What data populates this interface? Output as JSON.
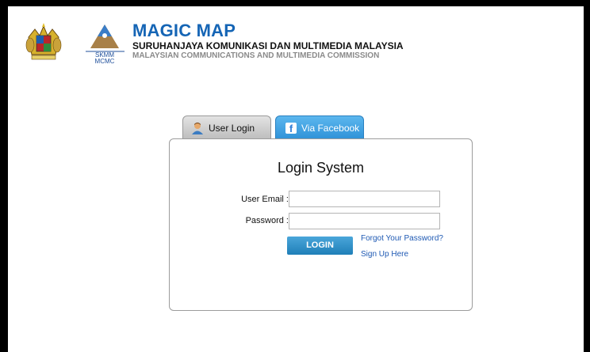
{
  "header": {
    "title": "MAGIC MAP",
    "subtitle_ms": "SURUHANJAYA KOMUNIKASI DAN MULTIMEDIA MALAYSIA",
    "subtitle_en": "MALAYSIAN COMMUNICATIONS AND MULTIMEDIA COMMISSION",
    "logo_text_top": "SKMM",
    "logo_text_bottom": "MCMC"
  },
  "tabs": [
    {
      "label": "User Login",
      "icon": "user-icon",
      "active": false
    },
    {
      "label": "Via Facebook",
      "icon": "facebook-icon",
      "active": true
    }
  ],
  "login": {
    "title": "Login System",
    "email_label": "User Email :",
    "email_value": "",
    "password_label": "Password :",
    "password_value": "",
    "button_label": "LOGIN",
    "forgot_link": "Forgot Your Password?",
    "signup_link": "Sign Up Here"
  },
  "colors": {
    "brand_blue": "#1565b5",
    "facebook_tab": "#3fa0e2",
    "login_button": "#2a8cc8",
    "link": "#1e59b3"
  }
}
